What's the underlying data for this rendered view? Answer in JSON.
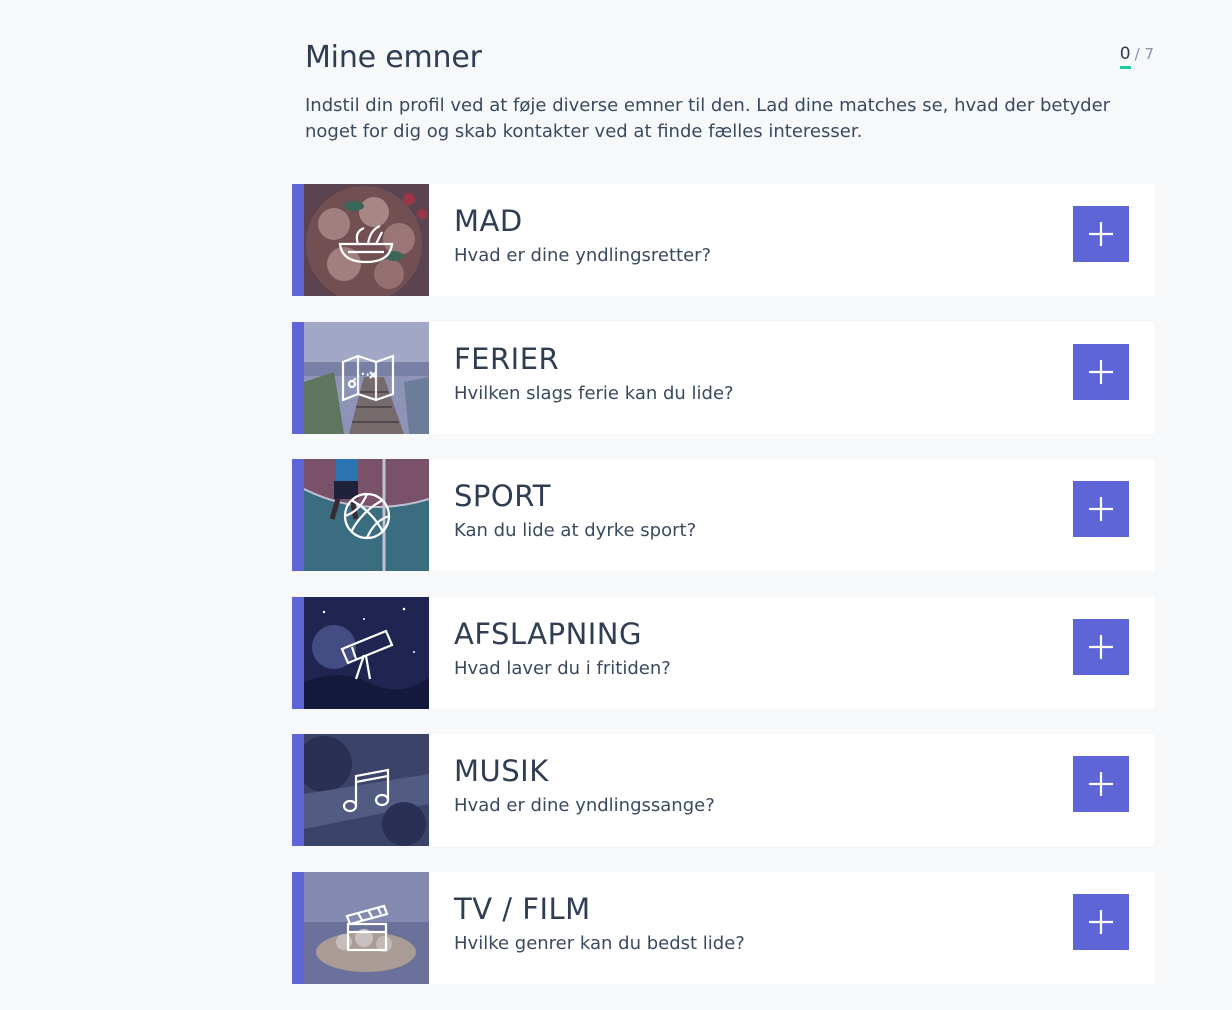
{
  "header": {
    "title": "Mine emner",
    "counter_current": "0",
    "counter_total": "/ 7",
    "intro": "Indstil din profil ved at føje diverse emner til den. Lad dine matches se, hvad der betyder noget for dig og skab kontakter ved at finde fælles interesser."
  },
  "colors": {
    "accent": "#5e66d7",
    "progress": "#1ec8a0"
  },
  "topics": [
    {
      "name": "MAD",
      "question": "Hvad er dine yndlingsretter?",
      "icon": "salad-bowl-icon"
    },
    {
      "name": "FERIER",
      "question": "Hvilken slags ferie kan du lide?",
      "icon": "treasure-map-icon"
    },
    {
      "name": "SPORT",
      "question": "Kan du lide at dyrke sport?",
      "icon": "basketball-icon"
    },
    {
      "name": "AFSLAPNING",
      "question": "Hvad laver du i fritiden?",
      "icon": "telescope-icon"
    },
    {
      "name": "MUSIK",
      "question": "Hvad er dine yndlingssange?",
      "icon": "music-note-icon"
    },
    {
      "name": "TV / FILM",
      "question": "Hvilke genrer kan du bedst lide?",
      "icon": "clapperboard-icon"
    }
  ]
}
